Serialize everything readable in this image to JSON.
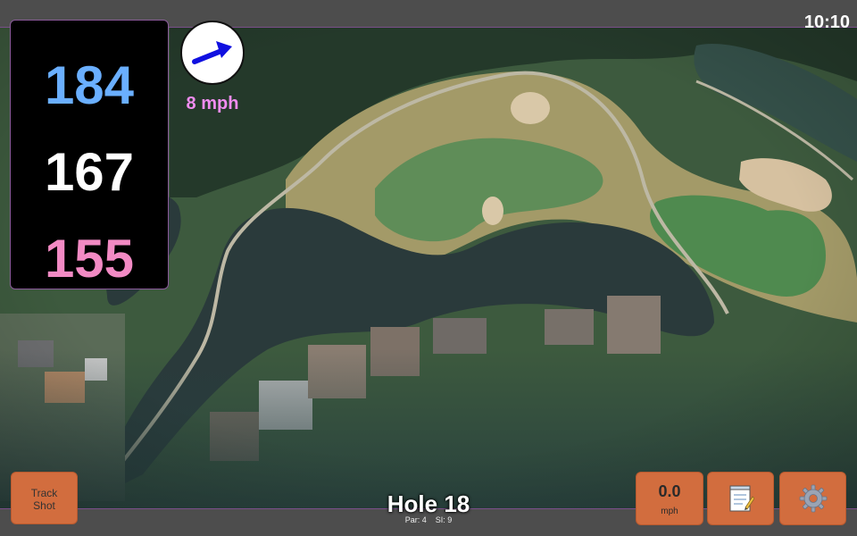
{
  "status": {
    "time": "10:10"
  },
  "distances": {
    "back": "184",
    "middle": "167",
    "front": "155"
  },
  "colors": {
    "back": "#6aafff",
    "middle": "#ffffff",
    "front": "#f28ac4",
    "wind_text": "#f08cf0",
    "button": "#d26d3e"
  },
  "wind": {
    "speed": "8 mph",
    "direction_icon": "arrow-right-icon"
  },
  "hole": {
    "title": "Hole 18",
    "par_label": "Par:",
    "par": "4",
    "si_label": "SI:",
    "si": "9"
  },
  "buttons": {
    "track_shot": "Track\nShot",
    "speed_value": "0.0",
    "speed_unit": "mph",
    "notes_icon": "notepad-icon",
    "settings_icon": "gear-icon"
  }
}
